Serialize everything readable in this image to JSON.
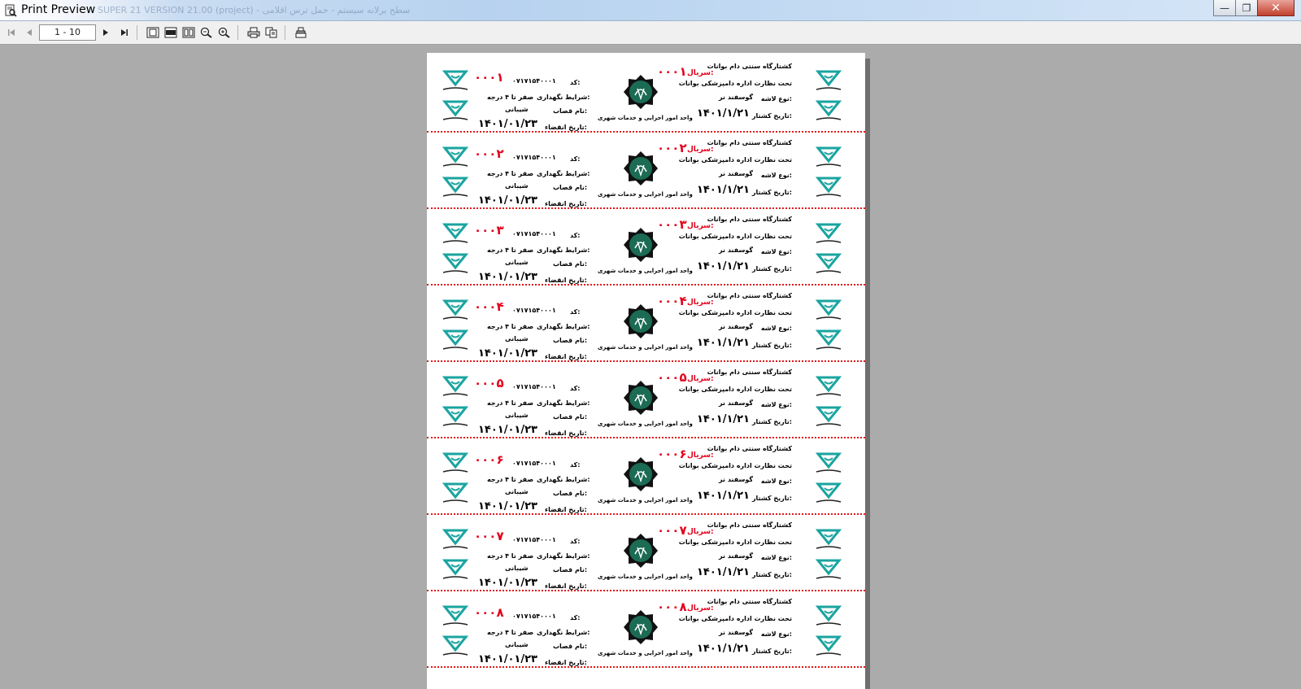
{
  "window": {
    "title": "Print Preview",
    "background_title": "SUPER 21 VERSION 21.00 (project) - سطح برلانه سیستم - حمل ترس اقلامی",
    "buttons": {
      "minimize": "—",
      "maximize": "❐",
      "close": "✕"
    }
  },
  "toolbar": {
    "page_range": "1 - 10",
    "icons": [
      "first-page-icon",
      "prev-page-icon",
      "next-page-icon",
      "last-page-icon",
      "single-page-icon",
      "page-width-icon",
      "two-pages-icon",
      "zoom-out-icon",
      "zoom-in-icon",
      "print-icon",
      "page-setup-icon",
      "export-icon"
    ]
  },
  "colors": {
    "serial_red": "#e3001b",
    "separator_red": "#e01818",
    "seal_green": "#1c6b54",
    "logo_teal": "#1aa4a0"
  },
  "labels": [
    {
      "serial_tag": "سریال:",
      "serial": "۰۰۰۱",
      "left_serial": "۰۰۰۱"
    },
    {
      "serial_tag": "سریال:",
      "serial": "۰۰۰۲",
      "left_serial": "۰۰۰۲"
    },
    {
      "serial_tag": "سریال:",
      "serial": "۰۰۰۳",
      "left_serial": "۰۰۰۳"
    },
    {
      "serial_tag": "سریال:",
      "serial": "۰۰۰۴",
      "left_serial": "۰۰۰۴"
    },
    {
      "serial_tag": "سریال:",
      "serial": "۰۰۰۵",
      "left_serial": "۰۰۰۵"
    },
    {
      "serial_tag": "سریال:",
      "serial": "۰۰۰۶",
      "left_serial": "۰۰۰۶"
    },
    {
      "serial_tag": "سریال:",
      "serial": "۰۰۰۷",
      "left_serial": "۰۰۰۷"
    },
    {
      "serial_tag": "سریال:",
      "serial": "۰۰۰۸",
      "left_serial": "۰۰۰۸"
    }
  ],
  "label_common": {
    "slaughterhouse": "کشتارگاه سنتی دام بوانات",
    "supervision": "تحت نظارت اداره دامپزشکی بوانات",
    "carcass_type_label": "نوع لاشه:",
    "carcass_type_value": "گوسفند نر",
    "slaughter_date_label": "تاریخ کشتار:",
    "slaughter_date_value": "۱۴۰۱/۱/۲۱",
    "unit_text": "واحد امور اجرایی و خدمات شهری",
    "code_label": "کد:",
    "code_value": "۰۷۱۷۱۵۴۰۰۰۱",
    "storage_label": "شرایط نگهداری:",
    "storage_value": "صفر تا ۴ درجه",
    "butcher_label": "نام قصاب:",
    "butcher_value": "شیبانی",
    "expiry_label": "تاریخ انقضاء:",
    "expiry_value": "۱۴۰۱/۰۱/۲۳",
    "vet_org": "سازمان دامپزشکی کشور"
  }
}
